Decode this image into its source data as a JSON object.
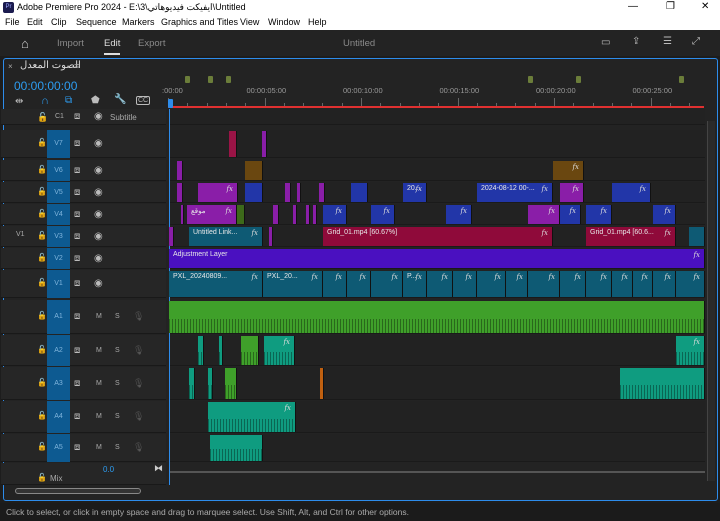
{
  "window": {
    "app_icon": "Pr",
    "title": "Adobe Premiere Pro 2024 - E:\\3\\ايفيكت فيديوهاتي\\Untitled",
    "controls": [
      "—",
      "❐",
      "✕"
    ]
  },
  "menu": [
    "File",
    "Edit",
    "Clip",
    "Sequence",
    "Markers",
    "Graphics and Titles",
    "View",
    "Window",
    "Help"
  ],
  "header": {
    "home_icon": "home-icon",
    "tabs": [
      "Import",
      "Edit",
      "Export"
    ],
    "active_tab": "Edit",
    "project_title": "Untitled"
  },
  "timeline": {
    "sequence_name": "الصوت المعدل",
    "timecode": "00:00:00:00",
    "ruler_labels": [
      ":00:00",
      "00:00:05:00",
      "00:00:10:00",
      "00:00:15:00",
      "00:00:20:00",
      "00:00:25:00"
    ],
    "subtitle_track": {
      "name": "C1",
      "label": "Subtitle"
    },
    "video_tracks": [
      "V7",
      "V6",
      "V5",
      "V4",
      "V3",
      "V2",
      "V1"
    ],
    "source_patch": "V1",
    "audio_tracks": [
      "A1",
      "A2",
      "A3",
      "A4",
      "A5"
    ],
    "audio_buttons": {
      "mute": "M",
      "solo": "S"
    },
    "mix": {
      "label": "Mix",
      "value": "0.0"
    },
    "clip_labels": {
      "fx": "fx",
      "v5_a": "20...",
      "v5_b": "2024-08-12 00-...",
      "v4_a": "موقع",
      "v3_a": "Untitled Link...",
      "v3_b": "Grid_01.mp4 [60.67%]",
      "v3_c": "Grid_01.mp4 [60.6...",
      "v2_a": "Adjustment Layer",
      "v1_a": "PXL_20240809...",
      "v1_b": "PXL_20...",
      "v1_c": "P..."
    }
  },
  "colors": {
    "accent": "#2d8ceb",
    "timecode": "#2d9cf0",
    "playhead": "#2d8ceb",
    "work_area": "#e03030"
  },
  "status": "Click to select, or click in empty space and drag to marquee select. Use Shift, Alt, and Ctrl for other options."
}
